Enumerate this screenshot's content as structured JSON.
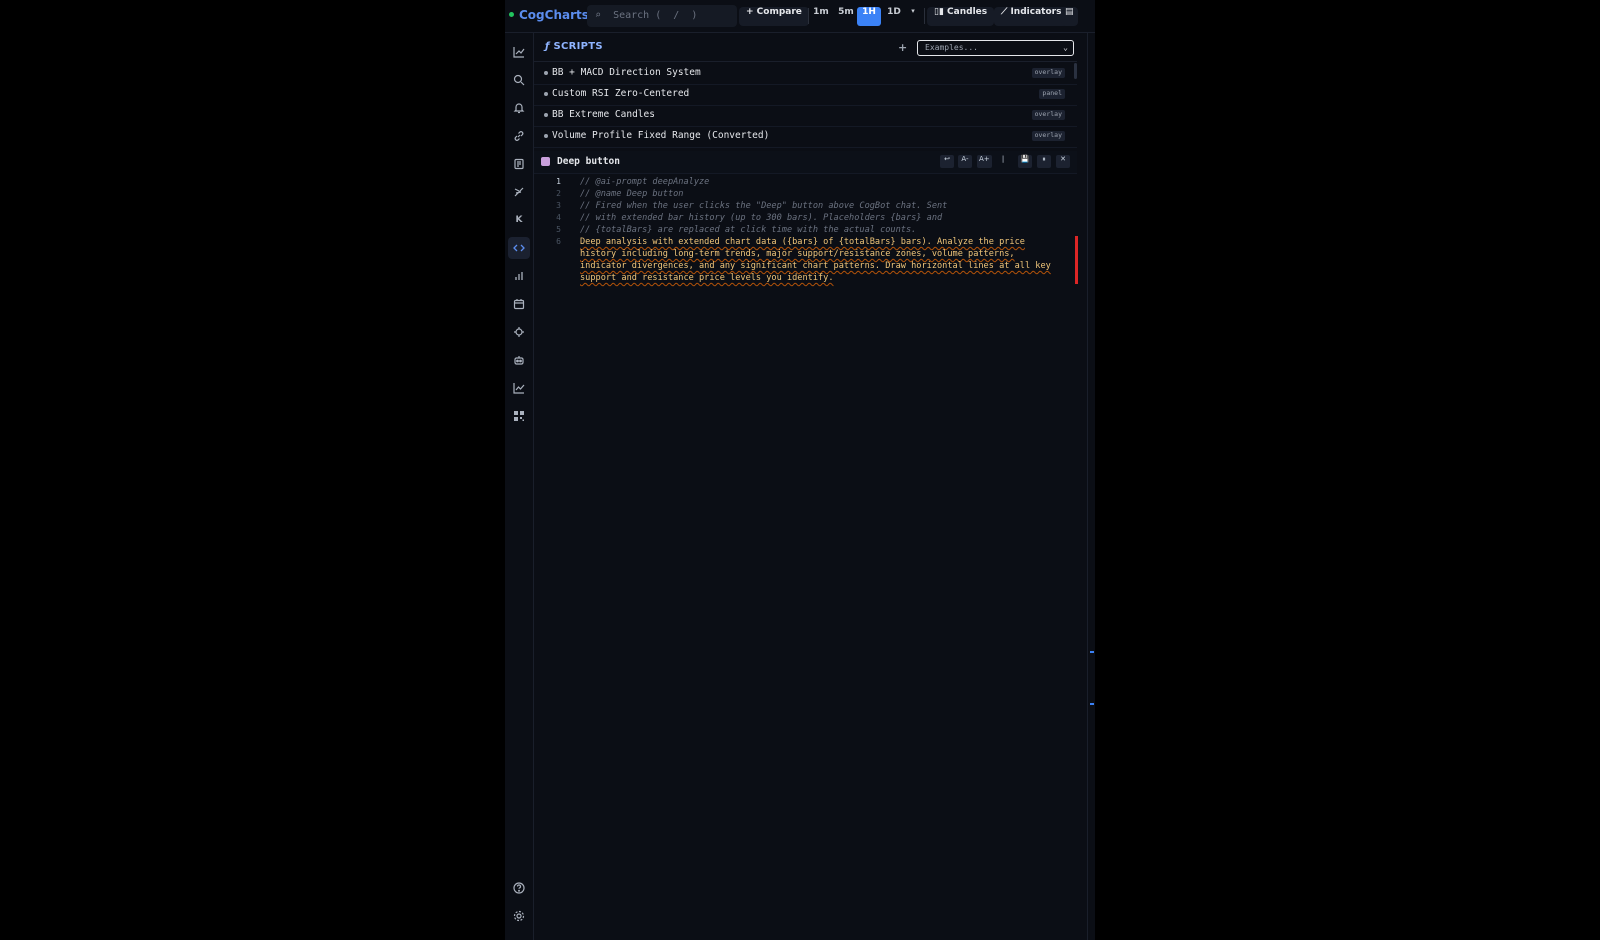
{
  "brand": {
    "name": "CogCharts"
  },
  "search": {
    "placeholder": "Search (  /  )"
  },
  "toolbar": {
    "compare": "+ Compare",
    "timeframes": [
      "1m",
      "5m",
      "1H",
      "1D"
    ],
    "active_timeframe": "1H",
    "more": "▾",
    "candles": "Candles",
    "indicators": "Indicators"
  },
  "rail": {
    "icons": [
      "chart-line-icon",
      "search-icon",
      "bell-icon",
      "link-icon",
      "book-icon",
      "drawing-tools-icon",
      "k-icon",
      "code-icon",
      "bar-chart-icon",
      "calendar-icon",
      "crosshair-icon",
      "robot-icon",
      "trend-icon",
      "qr-grid-icon",
      "help-icon",
      "settings-icon"
    ],
    "active": "code-icon",
    "k_label": "K"
  },
  "scripts": {
    "title": "SCRIPTS",
    "add_label": "+",
    "examples_placeholder": "Examples...",
    "items": [
      {
        "name": "BB + MACD Direction System",
        "badge": "overlay"
      },
      {
        "name": "Custom RSI Zero-Centered",
        "badge": "panel"
      },
      {
        "name": "BB Extreme Candles",
        "badge": "overlay"
      },
      {
        "name": "Volume Profile Fixed Range (Converted)",
        "badge": "overlay"
      }
    ]
  },
  "editor": {
    "title": "Deep button",
    "buttons": [
      "↩",
      "A-",
      "A+",
      "|",
      "💾",
      "⏸",
      "✕"
    ],
    "line_numbers": [
      "1",
      "2",
      "3",
      "4",
      "5",
      "6"
    ],
    "lines": [
      "// @ai-prompt deepAnalyze",
      "// @name Deep button",
      "// Fired when the user clicks the \"Deep\" button above CogBot chat. Sent",
      "// with extended bar history (up to 300 bars). Placeholders {bars} and",
      "// {totalBars} are replaced at click time with the actual counts.",
      "Deep analysis with extended chart data ({bars} of {totalBars} bars). Analyze the price",
      "history including long-term trends, major support/resistance zones, volume patterns,",
      "indicator divergences, and any significant chart patterns. Draw horizontal lines at all key",
      "support and resistance price levels you identify."
    ]
  },
  "colors": {
    "accent": "#3b82f6",
    "brand": "#5b8def",
    "status_dot": "#22c55e",
    "error_bar": "#dc2626"
  }
}
